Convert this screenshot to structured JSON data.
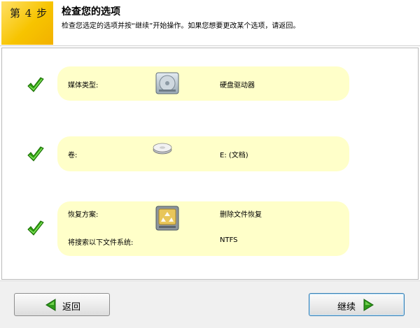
{
  "header": {
    "step_label": "第 4 步",
    "title": "检查您的选项",
    "subtitle": "检查您选定的选项并按“继续”开始操作。如果您想要更改某个选项，请返回。"
  },
  "summary": {
    "media_type": {
      "label": "媒体类型:",
      "value": "硬盘驱动器",
      "icon": "hard-drive-icon"
    },
    "volume": {
      "label": "卷:",
      "value": "E: (文档)",
      "icon": "volume-disk-icon"
    },
    "recovery": {
      "label": "恢复方案:",
      "value": "删除文件恢复",
      "icon": "recycle-drive-icon",
      "filesystem_label": "将搜索以下文件系统:",
      "filesystem_value": "NTFS"
    }
  },
  "buttons": {
    "back_label": "返回",
    "next_label": "继续"
  },
  "colors": {
    "step_box": "#f7c400",
    "card_background": "#ffffc9",
    "check_green": "#2e9e0f",
    "arrow_green": "#2f9a1a",
    "next_button_border": "#3c7fb1"
  }
}
